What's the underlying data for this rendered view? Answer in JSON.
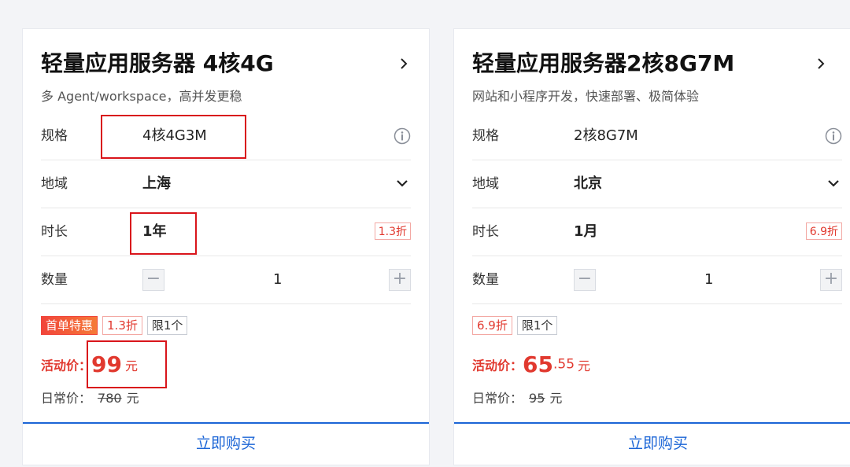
{
  "cards": [
    {
      "title": "轻量应用服务器 4核4G",
      "subtitle": "多 Agent/workspace，高并发更稳",
      "spec": {
        "label": "规格",
        "value": "4核4G3M"
      },
      "region": {
        "label": "地域",
        "value": "上海"
      },
      "duration": {
        "label": "时长",
        "value": "1年",
        "discount": "1.3折"
      },
      "quantity": {
        "label": "数量",
        "value": "1",
        "minus": "−",
        "plus": "+"
      },
      "tags": {
        "first_order": "首单特惠",
        "discount": "1.3折",
        "limit": "限1个"
      },
      "price": {
        "label": "活动价：",
        "integer": "99",
        "decimal": "",
        "unit": "元"
      },
      "original": {
        "label": "日常价：",
        "value": "780",
        "unit": "元"
      },
      "buy_label": "立即购买"
    },
    {
      "title": "轻量应用服务器2核8G7M",
      "subtitle": "网站和小程序开发，快速部署、极简体验",
      "spec": {
        "label": "规格",
        "value": "2核8G7M"
      },
      "region": {
        "label": "地域",
        "value": "北京"
      },
      "duration": {
        "label": "时长",
        "value": "1月",
        "discount": "6.9折"
      },
      "quantity": {
        "label": "数量",
        "value": "1",
        "minus": "−",
        "plus": "+"
      },
      "tags": {
        "discount": "6.9折",
        "limit": "限1个"
      },
      "price": {
        "label": "活动价：",
        "integer": "65",
        "decimal": ".55",
        "unit": "元"
      },
      "original": {
        "label": "日常价：",
        "value": "95",
        "unit": "元"
      },
      "buy_label": "立即购买"
    }
  ],
  "colors": {
    "accent_red": "#e1392f",
    "highlight_red": "#d9151b",
    "buy_blue": "#1b65d6"
  },
  "icons": [
    "chevron-right-icon",
    "info-icon",
    "chevron-down-icon"
  ]
}
